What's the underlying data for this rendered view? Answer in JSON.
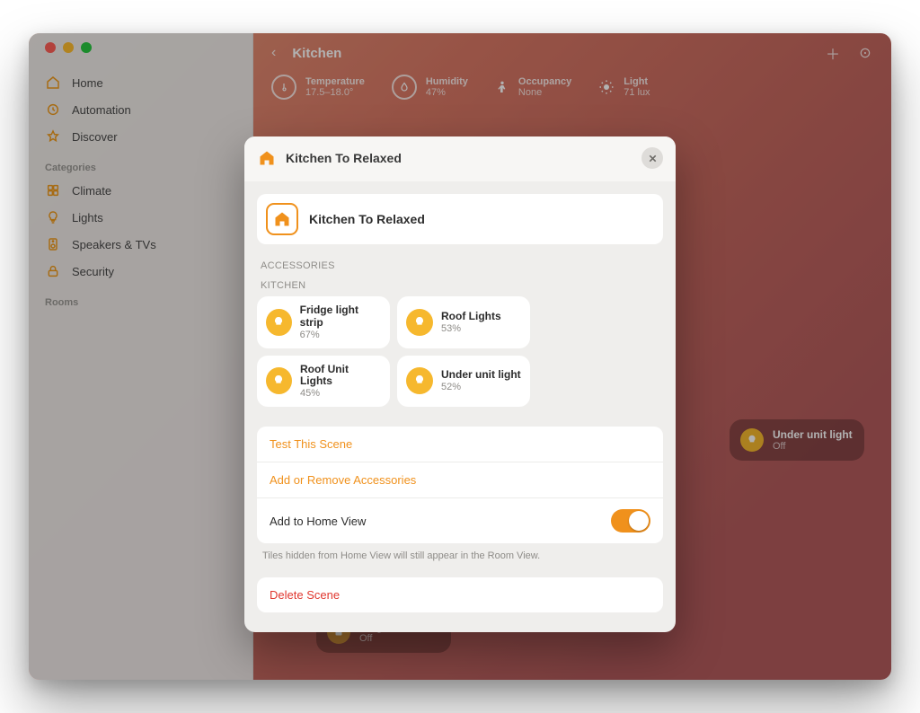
{
  "window": {
    "sidebar": {
      "nav": [
        {
          "icon": "house",
          "label": "Home"
        },
        {
          "icon": "clock",
          "label": "Automation"
        },
        {
          "icon": "star",
          "label": "Discover"
        }
      ],
      "categories_header": "Categories",
      "categories": [
        {
          "icon": "grid",
          "label": "Climate"
        },
        {
          "icon": "bulb",
          "label": "Lights"
        },
        {
          "icon": "speaker",
          "label": "Speakers & TVs"
        },
        {
          "icon": "lock",
          "label": "Security"
        }
      ],
      "rooms_header": "Rooms"
    },
    "room": {
      "title": "Kitchen",
      "metrics": [
        {
          "icon": "thermo",
          "label": "Temperature",
          "value": "17.5–18.0°"
        },
        {
          "icon": "drop",
          "label": "Humidity",
          "value": "47%"
        },
        {
          "icon": "person",
          "label": "Occupancy",
          "value": "None"
        },
        {
          "icon": "sun",
          "label": "Light",
          "value": "71 lux"
        }
      ],
      "bg_tiles": [
        {
          "name": "Under unit light",
          "state": "Off"
        },
        {
          "name": "Plug",
          "state": "Off"
        }
      ]
    }
  },
  "modal": {
    "header_title": "Kitchen To Relaxed",
    "scene_name": "Kitchen To Relaxed",
    "accessories_header": "ACCESSORIES",
    "room_header": "KITCHEN",
    "accessories": [
      {
        "name": "Fridge light strip",
        "pct": "67%"
      },
      {
        "name": "Roof Lights",
        "pct": "53%"
      },
      {
        "name": "Roof Unit Lights",
        "pct": "45%"
      },
      {
        "name": "Under unit light",
        "pct": "52%"
      }
    ],
    "actions": {
      "test": "Test This Scene",
      "add_remove": "Add or Remove Accessories",
      "home_view": "Add to Home View",
      "home_view_on": true,
      "hint": "Tiles hidden from Home View will still appear in the Room View.",
      "delete": "Delete Scene"
    }
  }
}
